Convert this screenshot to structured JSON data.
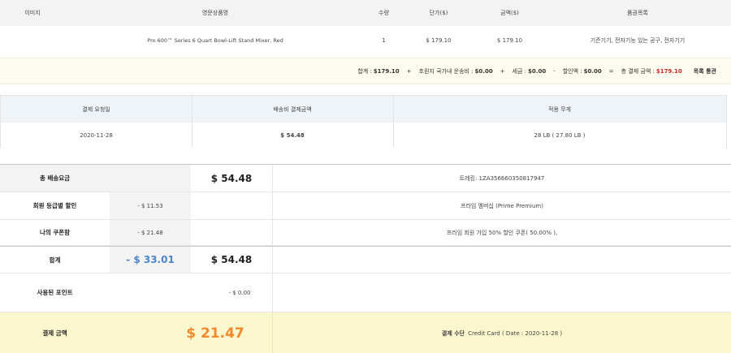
{
  "product_table": {
    "headers": {
      "image": "이미지",
      "product_name": "영문상품명",
      "qty": "수량",
      "unit_price": "단가($)",
      "amount": "금액($)",
      "category": "품권목록"
    },
    "row": {
      "product_name": "Pro 600™ Series 6 Quart Bowl-Lift Stand Mixer, Red",
      "qty": "1",
      "unit_price": "$ 179.10",
      "amount": "$ 179.10",
      "category": "기즌기기, 전자기능 있는 공구, 전자기기"
    }
  },
  "totals_strip": {
    "sum_label": "합계 :",
    "sum_value": "$179.10",
    "plus1": "+",
    "intl_ship_label": "초원지 국가내 운송비 :",
    "intl_ship_value": "$0.00",
    "plus2": "+",
    "tax_label": "세금 :",
    "tax_value": "$0.00",
    "minus": "-",
    "discount_label": "할인액 :",
    "discount_value": "$0.00",
    "equals": "=",
    "total_label": "총 결제 금액 :",
    "total_value": "$179.10",
    "category_label": "목록 통관"
  },
  "payment_table": {
    "headers": {
      "request_date": "결제 요청일",
      "ship_fee": "배송비 결제금액",
      "weight": "적용 무게"
    },
    "row": {
      "request_date": "2020-11-28",
      "ship_fee": "$ 54.48",
      "weight": "28 LB ( 27.80 LB )"
    }
  },
  "shipping": {
    "total_fee": {
      "label": "총 배송요금",
      "value": "$ 54.48",
      "note": "트레킹: 1ZA356660350817947"
    },
    "member_discount": {
      "label": "회원 등급별 할인",
      "value": "- $ 11.53",
      "note": "프라임 멤버십 (Prime Premium)"
    },
    "my_coupon": {
      "label": "나의 쿠폰함",
      "value": "- $ 21.48",
      "note": "프라임 회원 가입 50% 할인 쿠폰( 50.00% ),"
    },
    "subtotal": {
      "label": "합계",
      "discount_total": "- $ 33.01",
      "value": "$ 54.48"
    },
    "points": {
      "label": "사용된 포인트",
      "value": "- $ 0.00"
    },
    "payment": {
      "label": "결제 금액",
      "value": "$ 21.47",
      "method_label": "결제 수단",
      "method_value": "Credit Card ( Date : 2020-11-28 )"
    }
  }
}
